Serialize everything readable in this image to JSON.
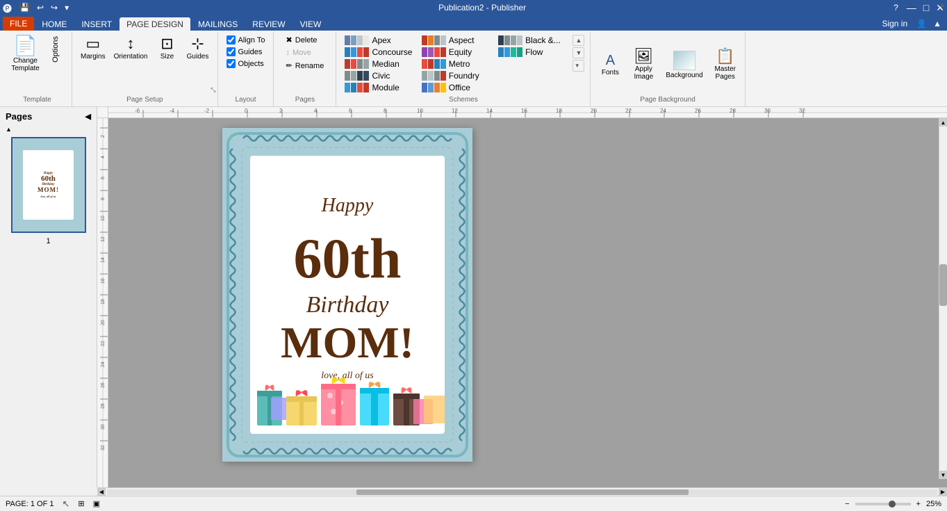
{
  "titlebar": {
    "title": "Publication2 - Publisher",
    "help_icon": "?",
    "minimize": "—",
    "maximize": "□",
    "close": "✕"
  },
  "quickaccess": {
    "save": "💾",
    "undo": "↩",
    "redo": "↪",
    "more": "▾"
  },
  "menutabs": {
    "file": "FILE",
    "home": "HOME",
    "insert": "INSERT",
    "pagedesign": "PAGE DESIGN",
    "mailings": "MAILINGS",
    "review": "REVIEW",
    "view": "VIEW",
    "signin": "Sign in"
  },
  "ribbon": {
    "template_group": "Template",
    "change_template_label": "Change\nTemplate",
    "options_label": "Options",
    "page_setup_group": "Page Setup",
    "margins_label": "Margins",
    "orientation_label": "Orientation",
    "size_label": "Size",
    "guides_label": "Guides",
    "layout_group": "Layout",
    "align_to": "Align To",
    "guides": "Guides",
    "objects": "Objects",
    "pages_group": "Pages",
    "delete_label": "Delete",
    "move_label": "Move",
    "rename_label": "Rename",
    "schemes_group": "Schemes",
    "page_background_group": "Page Background",
    "fonts_label": "Fonts",
    "apply_image_label": "Apply\nImage",
    "background_label": "Background",
    "master_pages_label": "Master\nPages"
  },
  "schemes": [
    {
      "name": "Apex",
      "colors": [
        "#5f7fa8",
        "#7a9fc2",
        "#c5c5c5",
        "#e8e8e8"
      ]
    },
    {
      "name": "Aspect",
      "colors": [
        "#c0392b",
        "#e67e22",
        "#7f8c8d",
        "#bdc3c7"
      ]
    },
    {
      "name": "Black &...",
      "colors": [
        "#2c3e50",
        "#7f8c8d",
        "#95a5a6",
        "#bdc3c7"
      ]
    },
    {
      "name": "Concourse",
      "colors": [
        "#2980b9",
        "#3498db",
        "#e74c3c",
        "#c0392b"
      ]
    },
    {
      "name": "Equity",
      "colors": [
        "#8e44ad",
        "#9b59b6",
        "#e74c3c",
        "#c0392b"
      ]
    },
    {
      "name": "Flow",
      "colors": [
        "#2980b9",
        "#3498db",
        "#1abc9c",
        "#16a085"
      ]
    },
    {
      "name": "Median",
      "colors": [
        "#c0392b",
        "#e74c3c",
        "#7f8c8d",
        "#95a5a6"
      ]
    },
    {
      "name": "Metro",
      "colors": [
        "#e74c3c",
        "#c0392b",
        "#2980b9",
        "#3498db"
      ]
    },
    {
      "name": "Civic",
      "colors": [
        "#7f8c8d",
        "#95a5a6",
        "#2c3e50",
        "#34495e"
      ]
    },
    {
      "name": "Foundry",
      "colors": [
        "#95a5a6",
        "#bdc3c7",
        "#7f8c8d",
        "#c0392b"
      ]
    },
    {
      "name": "Module",
      "colors": [
        "#3498db",
        "#2980b9",
        "#e74c3c",
        "#c0392b"
      ]
    },
    {
      "name": "Office",
      "colors": [
        "#4472c4",
        "#5b9bd5",
        "#ed7d31",
        "#ffc000"
      ]
    }
  ],
  "pages": {
    "title": "Pages",
    "page_num": "1"
  },
  "card": {
    "happy": "Happy",
    "60th": "60th",
    "birthday": "Birthday",
    "mom": "MOM!",
    "love": "love, all of us"
  },
  "statusbar": {
    "page_info": "PAGE: 1 OF 1",
    "zoom_percent": "25%",
    "zoom_icon": "⊞",
    "view_icons": [
      "⊞",
      "▣",
      "◫"
    ]
  }
}
